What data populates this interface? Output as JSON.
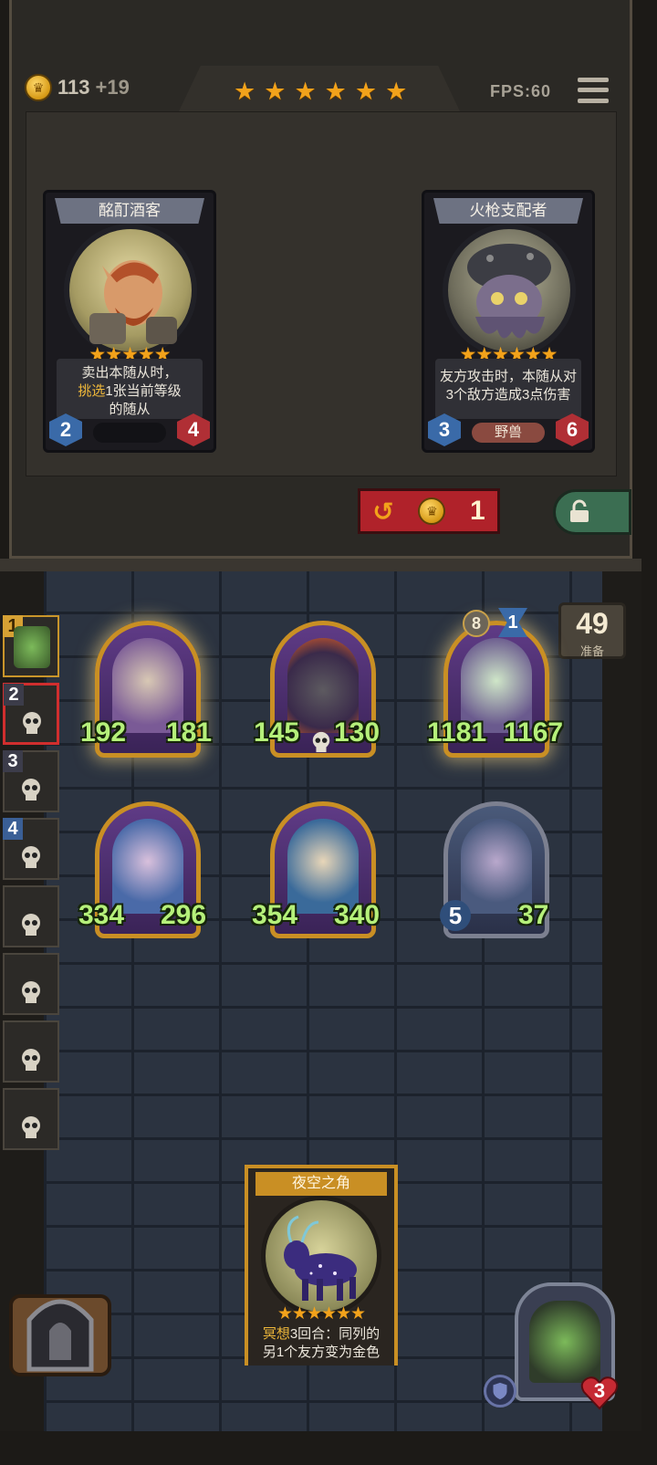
{
  "header": {
    "gold": "113",
    "gold_gain": "+19",
    "tier_stars": 6,
    "fps": "FPS:60"
  },
  "shop": {
    "cards": [
      {
        "name": "酩酊酒客",
        "stars": 5,
        "desc_line1": "卖出本随从时，",
        "desc_hl": "挑选",
        "desc_line2_rest": "1张当前等级",
        "desc_line3": "的随从",
        "attack": "2",
        "health": "4",
        "tribe": ""
      },
      {
        "name": "火枪支配者",
        "stars": 6,
        "desc_line1": "友方攻击时，本随从对",
        "desc_line2": "3个敌方造成3点伤害",
        "attack": "3",
        "health": "6",
        "tribe": "野兽"
      }
    ],
    "refresh_cost": "1"
  },
  "board": {
    "minions": [
      {
        "attack": "192",
        "health": "181"
      },
      {
        "attack": "145",
        "health": "130"
      },
      {
        "attack": "1181",
        "health": "1167",
        "tier": "8",
        "count": "1"
      },
      {
        "attack": "334",
        "health": "296"
      },
      {
        "attack": "354",
        "health": "340"
      },
      {
        "attack": "5",
        "health": "37"
      }
    ],
    "timer": "49",
    "timer_label": "准备"
  },
  "sidebar": {
    "slots": [
      "1",
      "2",
      "3",
      "4",
      "",
      "",
      "",
      ""
    ]
  },
  "hand_card": {
    "name": "夜空之角",
    "stars": 6,
    "desc_hl": "冥想",
    "desc_line1_rest": "3回合：同列的",
    "desc_line2": "另1个友方变为金色"
  },
  "hero": {
    "health": "3"
  },
  "icons": [
    "coin-icon",
    "star-icon",
    "menu-icon",
    "refresh-icon",
    "lock-icon",
    "skull-icon",
    "shield-icon",
    "heart-icon"
  ],
  "colors": {
    "gold": "#f2a21b",
    "refresh": "#b0222a",
    "lock": "#3b6e52",
    "stat_green": "#b5f07a"
  }
}
